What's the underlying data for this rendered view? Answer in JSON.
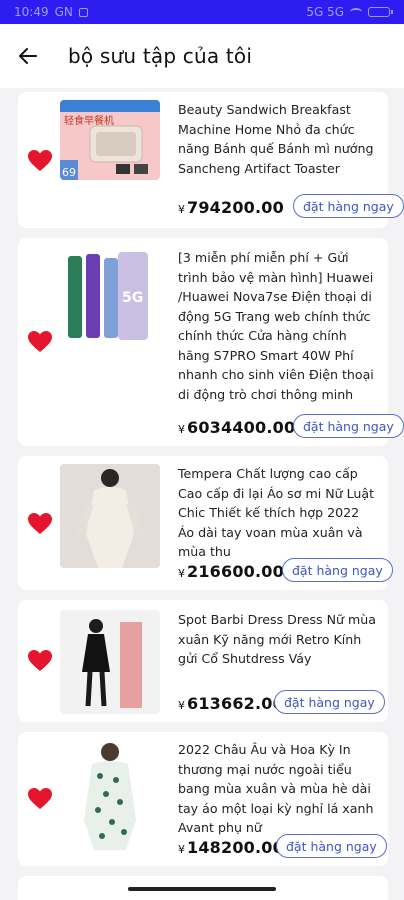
{
  "status_bar": {
    "time": "10:49",
    "carrier": "GN",
    "signal_text": "5G 5G"
  },
  "header": {
    "title": "bộ sưu tập của tôi"
  },
  "colors": {
    "status_bar": "#2d1df0",
    "heart": "#e4152d",
    "button_border": "#5a6fd1",
    "button_text": "#3c56c8"
  },
  "products": [
    {
      "title": "Beauty Sandwich Breakfast Machine Home Nhỏ đa chức năng Bánh quế Bánh mì nướng Sancheng Artifact Toaster",
      "currency": "¥",
      "price": "794200.00",
      "button": "đặt hàng ngay",
      "thumb_caption": "轻食早餐机",
      "thumb_badge": "69"
    },
    {
      "title": "[3 miễn phí miễn phí + Gửi trình bảo vệ màn hình] Huawei /Huawei Nova7se Điện thoại di động 5G Trang web chính thức chính thức Cửa hàng chính hãng S7PRO Smart 40W Phí nhanh cho sinh viên Điện thoại di động trò chơi thông minh",
      "currency": "¥",
      "price": "6034400.00",
      "button": "đặt hàng ngay",
      "thumb_caption": "5G"
    },
    {
      "title": "Tempera Chất lượng cao cấp Cao cấp đi lại Áo sơ mi Nữ Luật Chic Thiết kế thích hợp 2022 Áo dài tay voan mùa xuân và mùa thu",
      "currency": "¥",
      "price": "216600.00",
      "button": "đặt hàng ngay"
    },
    {
      "title": "Spot Barbi Dress Dress Nữ mùa xuân Kỹ năng mới Retro Kính gửi Cổ Shutdress Váy",
      "currency": "¥",
      "price": "613662.00",
      "button": "đặt hàng ngay"
    },
    {
      "title": "2022 Châu Âu và Hoa Kỳ In thương mại nước ngoài tiểu bang mùa xuân và mùa hè dài tay áo một loại kỳ nghỉ lá xanh Avant phụ nữ",
      "currency": "¥",
      "price": "148200.00",
      "button": "đặt hàng ngay"
    }
  ]
}
